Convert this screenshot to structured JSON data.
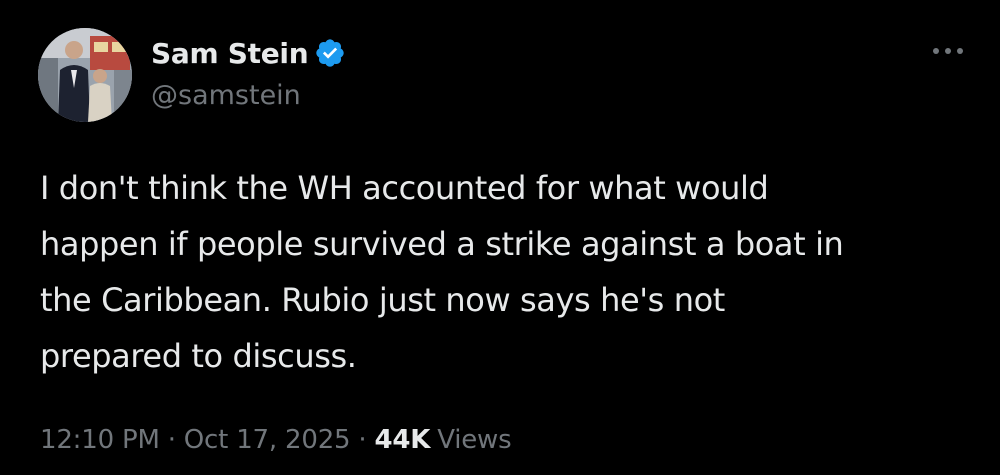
{
  "author": {
    "display_name": "Sam Stein",
    "handle": "@samstein",
    "verified": true,
    "avatar_icon": "avatar-photo"
  },
  "tweet": {
    "text": "I don't think the WH accounted for what would\nhappen if people survived a strike against a boat in\nthe Caribbean. Rubio just now says he's not\nprepared to discuss.",
    "time": "12:10 PM",
    "separator": "·",
    "date": "Oct 17, 2025",
    "views_count": "44K",
    "views_label": "Views"
  },
  "icons": {
    "verified": "verified-badge-icon",
    "more": "more-options-icon"
  },
  "colors": {
    "background": "#000000",
    "primary_text": "#e7e9ea",
    "secondary_text": "#71767b",
    "verified_blue": "#1d9bf0"
  }
}
